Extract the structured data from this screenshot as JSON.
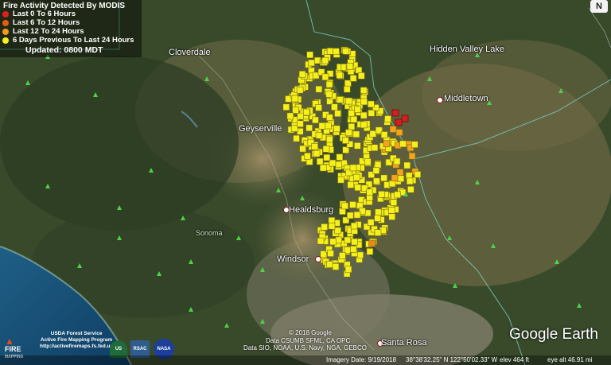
{
  "legend": {
    "title": "Fire Activity Detected By MODIS",
    "items": [
      {
        "label": "Last 0 To 6 Hours",
        "color": "#e02020"
      },
      {
        "label": "Last 6 To 12 Hours",
        "color": "#e85a10"
      },
      {
        "label": "Last 12 To 24 Hours",
        "color": "#f59a18"
      },
      {
        "label": "6 Days Previous To Last 24 Hours",
        "color": "#f5f21a"
      }
    ],
    "updated": "Updated: 0800 MDT"
  },
  "places": {
    "cloverdale": "Cloverdale",
    "hidden_valley": "Hidden Valley Lake",
    "middletown": "Middletown",
    "geyserville": "Geyserville",
    "healdsburg": "Healdsburg",
    "sonoma": "Sonoma",
    "windsor": "Windsor",
    "santa_rosa": "Santa Rosa"
  },
  "compass_icon": "north-arrow-icon",
  "compass_label": "N",
  "credits": {
    "line1": "© 2018 Google",
    "line2": "Data CSUMB SFML, CA OPC",
    "line3": "Data SIO, NOAA, U.S. Navy, NGA, GEBCO"
  },
  "google_earth": "Google Earth",
  "status": {
    "imagery": "Imagery Date: 9/19/2018",
    "coords": "38°38'32.25\" N  122°50'02.33\" W",
    "elev": "elev  464 ft",
    "eye": "eye alt  46.91 mi"
  },
  "agency": {
    "line1": "USDA Forest Service",
    "line2": "Active Fire Mapping Program",
    "line3": "http://activefiremaps.fs.fed.us",
    "fire_logo": "FIRE",
    "fire_logo_sub": "MAPPING",
    "usfs_badge": "US",
    "rsac_badge": "RSAC",
    "nasa_badge": "NASA"
  }
}
